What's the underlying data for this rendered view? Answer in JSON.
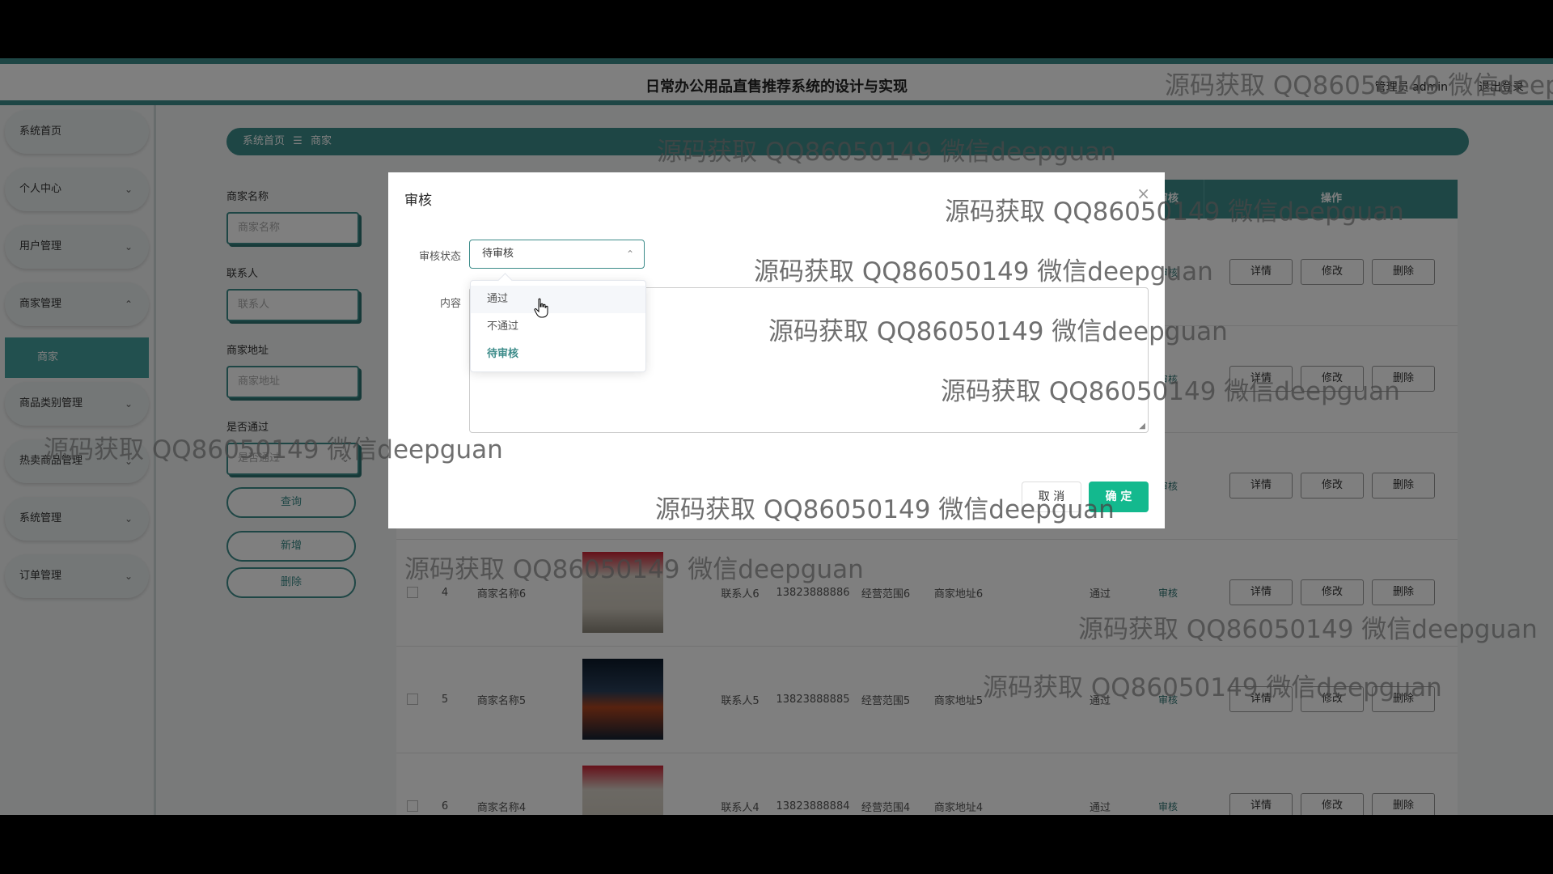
{
  "app_title": "日常办公用品直售推荐系统的设计与实现",
  "header": {
    "admin": "管理员 admin",
    "logout": "退出登录"
  },
  "sidebar": {
    "items": [
      {
        "label": "系统首页",
        "chev": ""
      },
      {
        "label": "个人中心",
        "chev": "⌄"
      },
      {
        "label": "用户管理",
        "chev": "⌄"
      },
      {
        "label": "商家管理",
        "chev": "⌃"
      },
      {
        "label": "商品类别管理",
        "chev": "⌄"
      },
      {
        "label": "热卖商品管理",
        "chev": "⌄"
      },
      {
        "label": "系统管理",
        "chev": "⌄"
      },
      {
        "label": "订单管理",
        "chev": "⌄"
      }
    ],
    "submenu_label": "商家"
  },
  "breadcrumb": {
    "home": "系统首页",
    "sep": "☰",
    "current": "商家"
  },
  "filters": {
    "name_label": "商家名称",
    "name_placeholder": "商家名称",
    "contact_label": "联系人",
    "contact_placeholder": "联系人",
    "address_label": "商家地址",
    "address_placeholder": "商家地址",
    "pass_label": "是否通过",
    "pass_placeholder": "是否通过",
    "query_btn": "查询",
    "add_btn": "新增",
    "delete_btn": "删除"
  },
  "table": {
    "headers": {
      "audit": "审核",
      "ops": "操作"
    },
    "actions": {
      "detail": "详情",
      "edit": "修改",
      "delete": "删除",
      "audit": "审核"
    },
    "rows": [
      {
        "index": "",
        "name": "",
        "contact": "",
        "phone": "",
        "scope": "",
        "address": "",
        "status": ""
      },
      {
        "index": "",
        "name": "",
        "contact": "",
        "phone": "",
        "scope": "",
        "address": "",
        "status": ""
      },
      {
        "index": "",
        "name": "",
        "contact": "",
        "phone": "",
        "scope": "",
        "address": "",
        "status": ""
      },
      {
        "index": "4",
        "name": "商家名称6",
        "contact": "联系人6",
        "phone": "13823888886",
        "scope": "经营范围6",
        "address": "商家地址6",
        "status": "通过"
      },
      {
        "index": "5",
        "name": "商家名称5",
        "contact": "联系人5",
        "phone": "13823888885",
        "scope": "经营范围5",
        "address": "商家地址5",
        "status": "通过"
      },
      {
        "index": "6",
        "name": "商家名称4",
        "contact": "联系人4",
        "phone": "13823888884",
        "scope": "经营范围4",
        "address": "商家地址4",
        "status": "通过"
      }
    ]
  },
  "dialog": {
    "title": "审核",
    "status_label": "审核状态",
    "status_value": "待审核",
    "content_label": "内容",
    "options": [
      "通过",
      "不通过",
      "待审核"
    ],
    "cancel": "取 消",
    "ok": "确 定"
  },
  "watermark": "源码获取 QQ86050149 微信deepguan",
  "colors": {
    "primary": "#3d8c8a",
    "confirm": "#13b98e"
  }
}
